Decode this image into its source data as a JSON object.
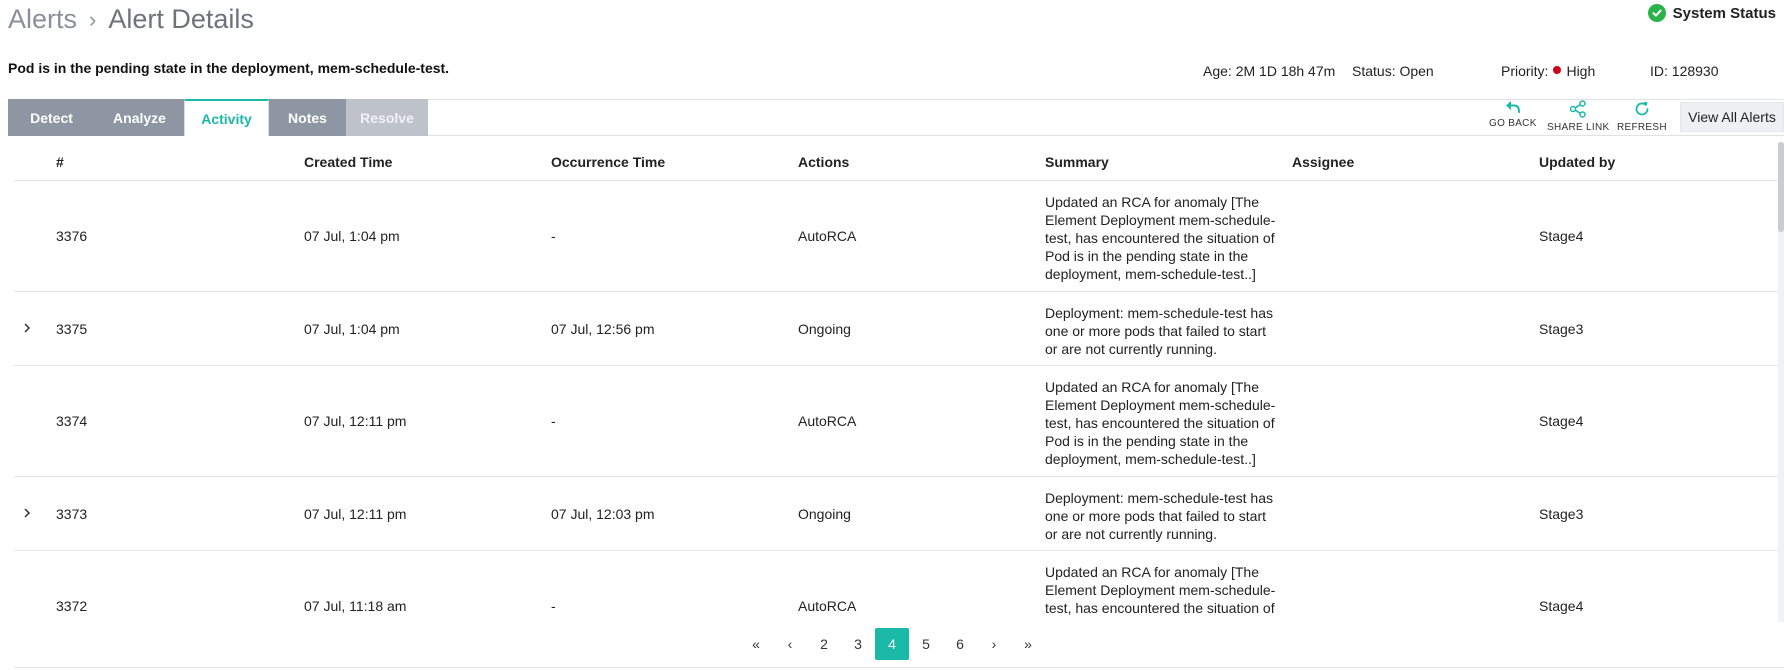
{
  "breadcrumb": {
    "parent": "Alerts",
    "separator": "›",
    "current": "Alert Details"
  },
  "system_status": {
    "label": "System Status",
    "color": "#2bb34a",
    "icon": "check-circle-icon"
  },
  "alert": {
    "title": "Pod is in the pending state in the deployment, mem-schedule-test.",
    "age": "Age: 2M 1D 18h 47m",
    "status": "Status: Open",
    "priority_label": "Priority:",
    "priority_value": "High",
    "priority_color": "#d0021b",
    "id": "ID: 128930"
  },
  "tabs": [
    {
      "label": "Detect",
      "state": "default"
    },
    {
      "label": "Analyze",
      "state": "default"
    },
    {
      "label": "Activity",
      "state": "active"
    },
    {
      "label": "Notes",
      "state": "default"
    },
    {
      "label": "Resolve",
      "state": "disabled"
    }
  ],
  "toolbar": {
    "go_back": "GO BACK",
    "share_link": "SHARE LINK",
    "refresh": "REFRESH",
    "view_all": "View All Alerts",
    "accent": "#1bb9a8"
  },
  "table": {
    "headers": [
      "#",
      "Created Time",
      "Occurrence Time",
      "Actions",
      "Summary",
      "Assignee",
      "Updated by"
    ],
    "rows": [
      {
        "expandable": false,
        "id": "3376",
        "created": "07 Jul, 1:04 pm",
        "occurrence": "-",
        "action": "AutoRCA",
        "summary": "Updated an RCA for anomaly [The Element Deployment mem-schedule-test, has encountered the situation of Pod is in the pending state in the deployment, mem-schedule-test..]",
        "assignee": "",
        "updated_by": "Stage4"
      },
      {
        "expandable": true,
        "id": "3375",
        "created": "07 Jul, 1:04 pm",
        "occurrence": "07 Jul, 12:56 pm",
        "action": "Ongoing",
        "summary": "Deployment: mem-schedule-test has one or more pods that failed to start or are not currently running.",
        "assignee": "",
        "updated_by": "Stage3"
      },
      {
        "expandable": false,
        "id": "3374",
        "created": "07 Jul, 12:11 pm",
        "occurrence": "-",
        "action": "AutoRCA",
        "summary": "Updated an RCA for anomaly [The Element Deployment mem-schedule-test, has encountered the situation of Pod is in the pending state in the deployment, mem-schedule-test..]",
        "assignee": "",
        "updated_by": "Stage4"
      },
      {
        "expandable": true,
        "id": "3373",
        "created": "07 Jul, 12:11 pm",
        "occurrence": "07 Jul, 12:03 pm",
        "action": "Ongoing",
        "summary": "Deployment: mem-schedule-test has one or more pods that failed to start or are not currently running.",
        "assignee": "",
        "updated_by": "Stage3"
      },
      {
        "expandable": false,
        "id": "3372",
        "created": "07 Jul, 11:18 am",
        "occurrence": "-",
        "action": "AutoRCA",
        "summary": "Updated an RCA for anomaly [The Element Deployment mem-schedule-test, has encountered the situation of Pod is in the pending state in the deployment, mem-schedule-test..]",
        "assignee": "",
        "updated_by": "Stage4"
      }
    ]
  },
  "pagination": {
    "first": "«",
    "prev": "‹",
    "pages": [
      "2",
      "3",
      "4",
      "5",
      "6"
    ],
    "current": "4",
    "next": "›",
    "last": "»"
  }
}
